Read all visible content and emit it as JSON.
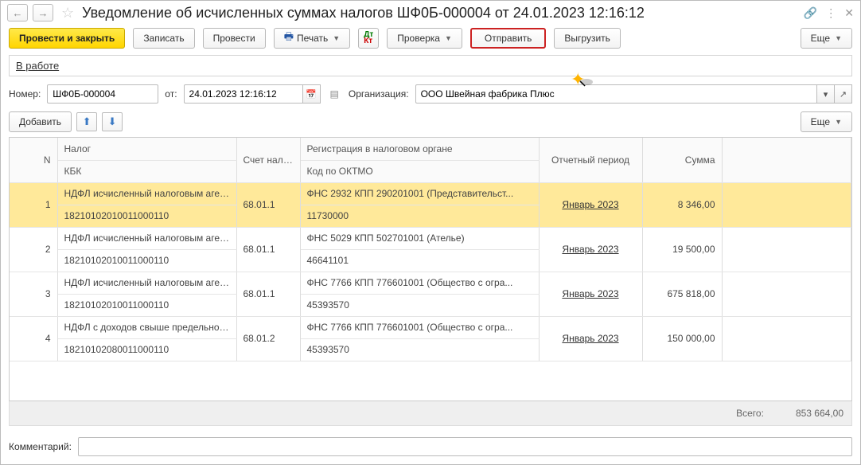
{
  "titlebar": {
    "title": "Уведомление об исчисленных суммах налогов ШФ0Б-000004 от 24.01.2023 12:16:12"
  },
  "toolbar": {
    "post_close": "Провести и закрыть",
    "save": "Записать",
    "post": "Провести",
    "print": "Печать",
    "check": "Проверка",
    "send": "Отправить",
    "export": "Выгрузить",
    "more": "Еще"
  },
  "status": {
    "text": "В работе"
  },
  "form": {
    "number_label": "Номер:",
    "number_value": "ШФ0Б-000004",
    "date_label": "от:",
    "date_value": "24.01.2023 12:16:12",
    "org_label": "Организация:",
    "org_value": "ООО Швейная фабрика Плюс"
  },
  "subtoolbar": {
    "add": "Добавить",
    "more": "Еще"
  },
  "table": {
    "headers": {
      "n": "N",
      "tax": "Налог",
      "kbk": "КБК",
      "account": "Счет налога",
      "registration": "Регистрация в налоговом органе",
      "oktmo": "Код по ОКТМО",
      "period": "Отчетный период",
      "sum": "Сумма"
    },
    "rows": [
      {
        "n": "1",
        "tax": "НДФЛ исчисленный налоговым агентом",
        "kbk": "18210102010011000110",
        "account": "68.01.1",
        "registration": "ФНС 2932 КПП 290201001 (Представительст...",
        "oktmo": "11730000",
        "period": "Январь 2023",
        "sum": "8 346,00",
        "selected": true
      },
      {
        "n": "2",
        "tax": "НДФЛ исчисленный налоговым агентом",
        "kbk": "18210102010011000110",
        "account": "68.01.1",
        "registration": "ФНС 5029 КПП 502701001 (Ателье)",
        "oktmo": "46641101",
        "period": "Январь 2023",
        "sum": "19 500,00",
        "selected": false
      },
      {
        "n": "3",
        "tax": "НДФЛ исчисленный налоговым агентом",
        "kbk": "18210102010011000110",
        "account": "68.01.1",
        "registration": "ФНС 7766 КПП 776601001 (Общество с огра...",
        "oktmo": "45393570",
        "period": "Январь 2023",
        "sum": "675 818,00",
        "selected": false
      },
      {
        "n": "4",
        "tax": "НДФЛ с доходов свыше предельной величин...",
        "kbk": "18210102080011000110",
        "account": "68.01.2",
        "registration": "ФНС 7766 КПП 776601001 (Общество с огра...",
        "oktmo": "45393570",
        "period": "Январь 2023",
        "sum": "150 000,00",
        "selected": false
      }
    ]
  },
  "totals": {
    "label": "Всего:",
    "value": "853 664,00"
  },
  "comment": {
    "label": "Комментарий:",
    "value": ""
  }
}
